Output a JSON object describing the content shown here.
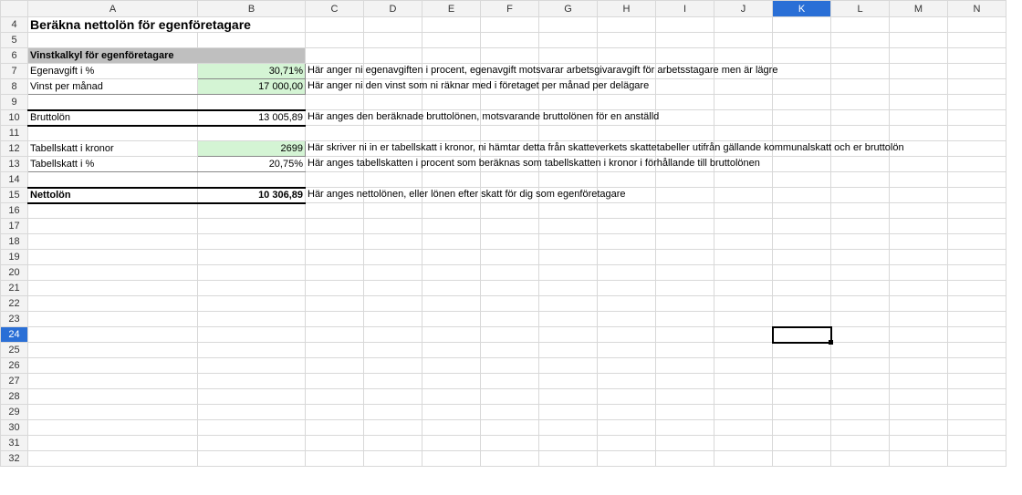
{
  "columns": [
    "A",
    "B",
    "C",
    "D",
    "E",
    "F",
    "G",
    "H",
    "I",
    "J",
    "K",
    "L",
    "M",
    "N"
  ],
  "rows_start": 4,
  "rows_end": 32,
  "selected_col": "K",
  "selected_row": 24,
  "selected_cell": "K24",
  "title": "Beräkna nettolön för egenföretagare",
  "section_header": "Vinstkalkyl för egenföretagare",
  "lines": {
    "egenavgift": {
      "label": "Egenavgift i %",
      "value": "30,71%",
      "note": "Här anger ni egenavgiften i procent, egenavgift motsvarar arbetsgivaravgift för arbetsstagare men är lägre"
    },
    "vinst": {
      "label": "Vinst per månad",
      "value": "17 000,00",
      "note": "Här anger ni den vinst som ni räknar med i företaget per månad per delägare"
    },
    "bruttolon": {
      "label": "Bruttolön",
      "value": "13 005,89",
      "note": "Här anges den beräknade bruttolönen, motsvarande bruttolönen för en anställd"
    },
    "tabellkr": {
      "label": "Tabellskatt i kronor",
      "value": "2699",
      "note": "Här skriver ni in er tabellskatt i kronor, ni hämtar detta från skatteverkets skattetabeller utifrån gällande kommunalskatt och er bruttolön"
    },
    "tabellpct": {
      "label": "Tabellskatt i %",
      "value": "20,75%",
      "note": "Här anges tabellskatten i procent som beräknas som tabellskatten i kronor i förhållande till bruttolönen"
    },
    "nettolon": {
      "label": "Nettolön",
      "value": "10 306,89",
      "note": "Här anges nettolönen, eller lönen efter skatt för dig som egenföretagare"
    }
  }
}
